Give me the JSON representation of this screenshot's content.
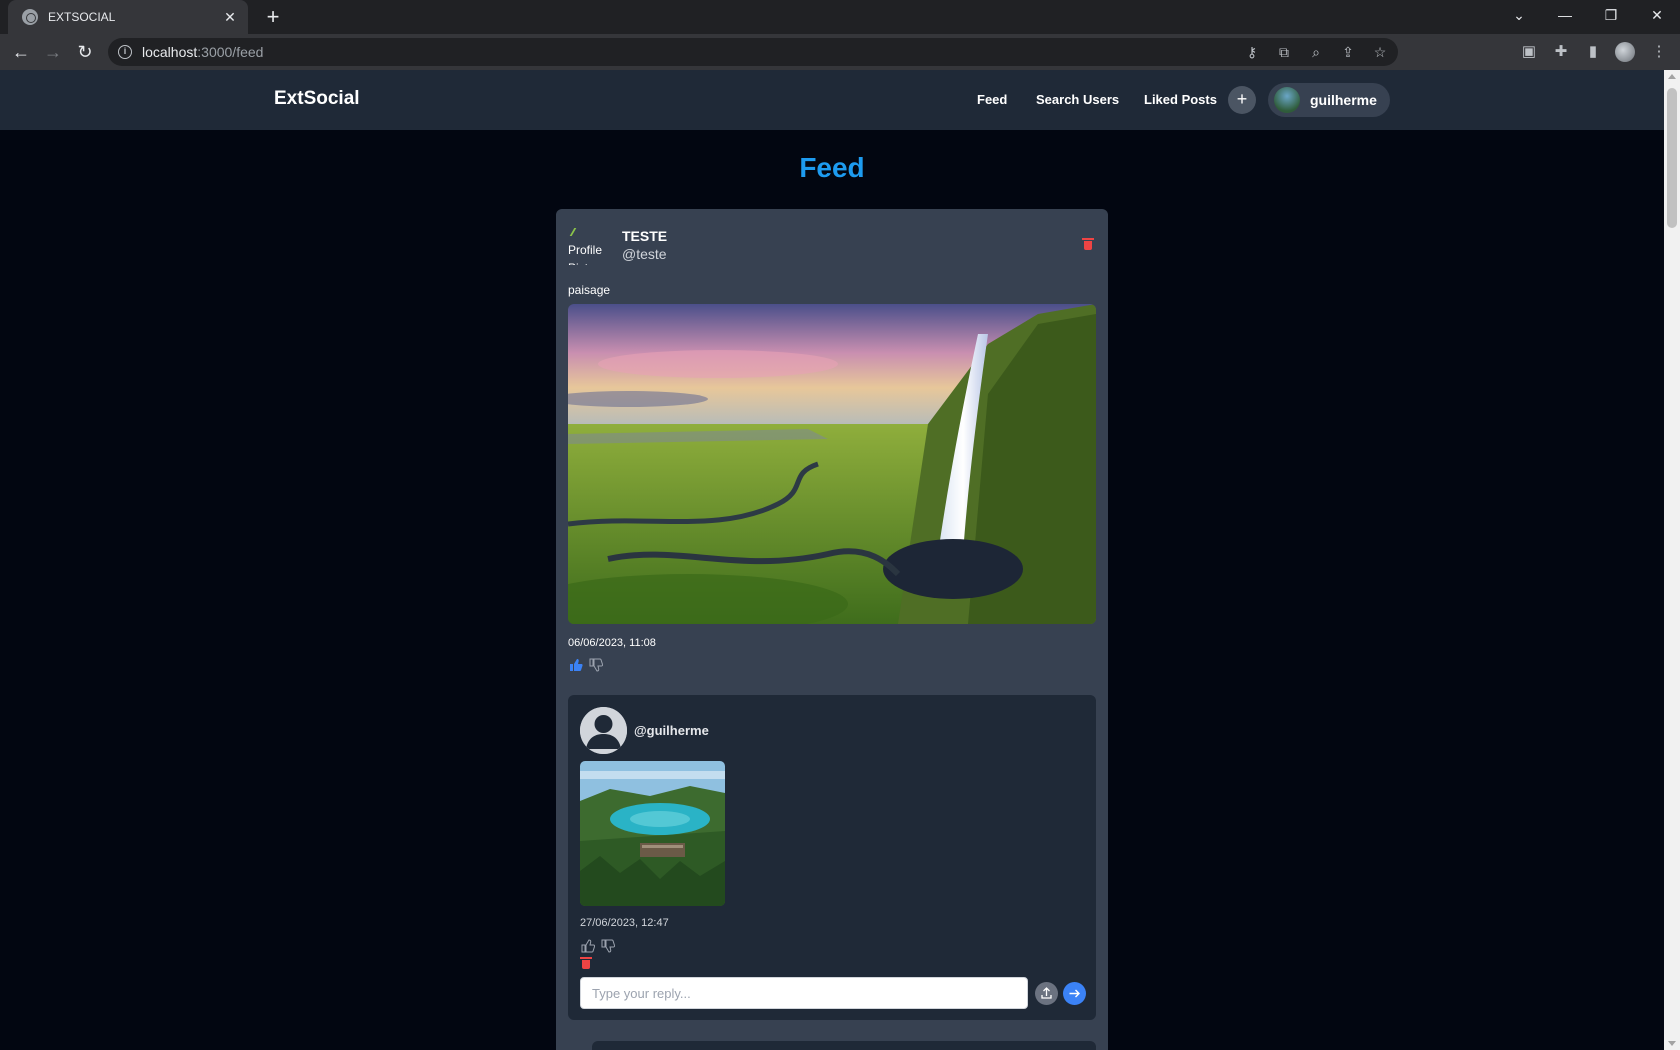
{
  "browser": {
    "tab_title": "EXTSOCIAL",
    "url_host": "localhost",
    "url_path": ":3000/feed"
  },
  "app": {
    "brand": "ExtSocial",
    "nav": {
      "feed": "Feed",
      "search_users": "Search Users",
      "liked_posts": "Liked Posts"
    },
    "add_label": "+",
    "username": "guilherme"
  },
  "page_title": "Feed",
  "post": {
    "profile_picture_alt": "Profile Picture",
    "name": "TESTE",
    "handle": "@teste",
    "text": "paisage",
    "date": "06/06/2023, 11:08",
    "liked": true
  },
  "reply": {
    "handle": "@guilherme",
    "date": "27/06/2023, 12:47",
    "input_placeholder": "Type your reply..."
  },
  "colors": {
    "accent": "#1d9bf0",
    "delete": "#ef4444",
    "like_active": "#3b82f6"
  }
}
